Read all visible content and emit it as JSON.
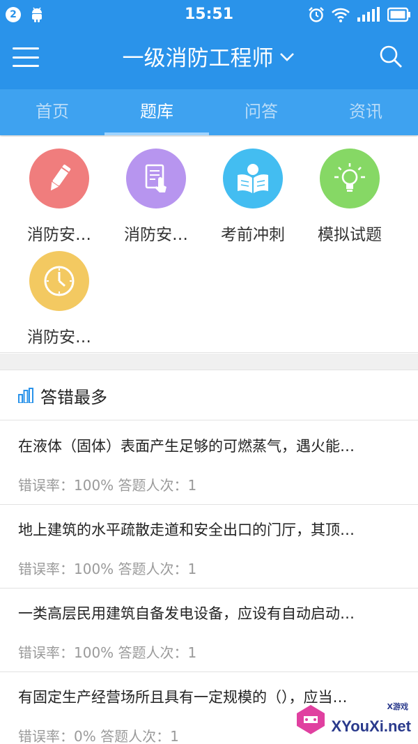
{
  "status_bar": {
    "badge": "2",
    "time": "15:51",
    "icons": [
      "android-icon",
      "alarm-icon",
      "wifi-icon",
      "signal-icon",
      "battery-icon"
    ]
  },
  "header": {
    "title": "一级消防工程师",
    "icons": [
      "menu-icon",
      "chevron-down-icon",
      "search-icon"
    ]
  },
  "tabs": [
    {
      "label": "首页",
      "active": false
    },
    {
      "label": "题库",
      "active": true
    },
    {
      "label": "问答",
      "active": false
    },
    {
      "label": "资讯",
      "active": false
    }
  ],
  "grid": [
    {
      "label": "消防安…",
      "icon": "pencil-icon",
      "color": "#f07d7d"
    },
    {
      "label": "消防安…",
      "icon": "document-touch-icon",
      "color": "#b795ef"
    },
    {
      "label": "考前冲刺",
      "icon": "reading-icon",
      "color": "#43bdf1"
    },
    {
      "label": "模拟试题",
      "icon": "lightbulb-icon",
      "color": "#86d865"
    },
    {
      "label": "消防安…",
      "icon": "clock-icon",
      "color": "#f3c961"
    }
  ],
  "section": {
    "title": "答错最多",
    "icon": "bar-chart-icon"
  },
  "questions": [
    {
      "text": "在液体（固体）表面产生足够的可燃蒸气，遇火能…",
      "meta": "错误率：100% 答题人次：1"
    },
    {
      "text": "地上建筑的水平疏散走道和安全出口的门厅，其顶…",
      "meta": "错误率：100% 答题人次：1"
    },
    {
      "text": "一类高层民用建筑自备发电设备，应设有自动启动…",
      "meta": "错误率：100% 答题人次：1"
    },
    {
      "text": "有固定生产经营场所且具有一定规模的（），应当…",
      "meta": "错误率：0% 答题人次：1"
    }
  ],
  "watermark": {
    "text": "XYouXi.net",
    "small": "X游戏"
  },
  "colors": {
    "primary": "#2a93ea",
    "tab_bg": "#3ea2f0",
    "divider": "#e2e2e2"
  }
}
